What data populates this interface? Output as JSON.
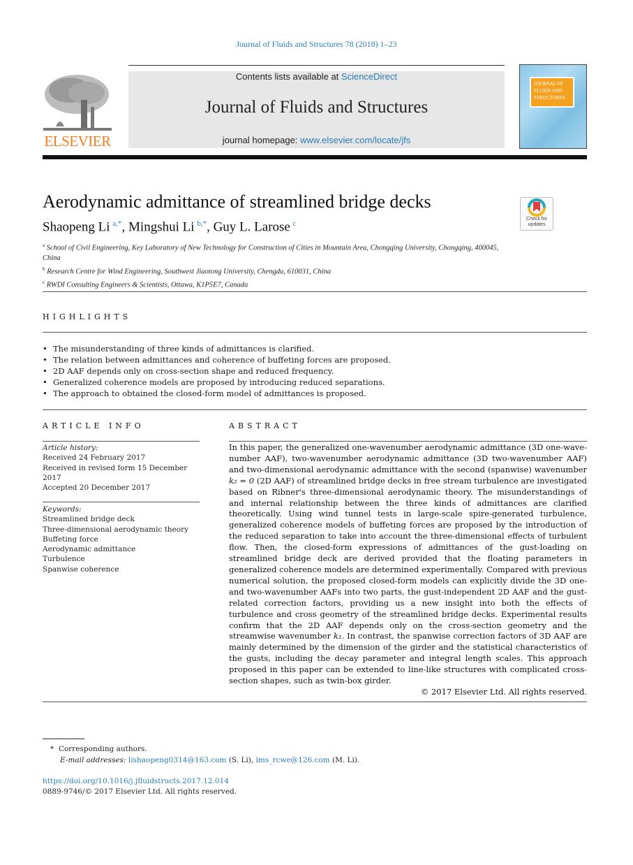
{
  "header": {
    "journal_reference": "Journal of Fluids and Structures 78 (2018) 1–23",
    "contents_prefix": "Contents lists available at ",
    "contents_link": "ScienceDirect",
    "journal_title": "Journal of Fluids and Structures",
    "homepage_prefix": "journal homepage: ",
    "homepage_link": "www.elsevier.com/locate/jfs",
    "publisher_logo_text": "ELSEVIER",
    "cover_title": "JOURNAL OF FLUIDS AND STRUCTURES",
    "check_updates_label": "Check for updates"
  },
  "article": {
    "title": "Aerodynamic admittance of streamlined bridge decks",
    "authors": [
      {
        "name": "Shaopeng Li",
        "sup": "a,*"
      },
      {
        "name": "Mingshui Li",
        "sup": "b,*"
      },
      {
        "name": "Guy L. Larose",
        "sup": "c"
      }
    ],
    "affiliations": [
      {
        "mark": "a",
        "text": "School of Civil Engineering, Key Laboratory of New Technology for Construction of Cities in Mountain Area, Chongqing University, Chongqing, 400045, China"
      },
      {
        "mark": "b",
        "text": "Research Centre for Wind Engineering, Southwest Jiaotong University, Chengdu, 610031, China"
      },
      {
        "mark": "c",
        "text": "RWDI Consulting Engineers & Scientists, Ottawa, K1P5E7, Canada"
      }
    ]
  },
  "highlights": {
    "heading": "HIGHLIGHTS",
    "items": [
      "The misunderstanding of three kinds of admittances is clarified.",
      "The relation between admittances and coherence of buffeting forces are proposed.",
      "2D AAF depends only on cross-section shape and reduced frequency.",
      "Generalized coherence models are proposed by introducing reduced separations.",
      "The approach to obtained the closed-form model of admittances is proposed."
    ]
  },
  "article_info": {
    "heading": "ARTICLE INFO",
    "history_label": "Article history:",
    "history": [
      "Received 24 February 2017",
      "Received in revised form 15 December 2017",
      "Accepted 20 December 2017"
    ],
    "keywords_label": "Keywords:",
    "keywords": [
      "Streamlined bridge deck",
      "Three-dimensional aerodynamic theory",
      "Buffeting force",
      "Aerodynamic admittance",
      "Turbulence",
      "Spanwise coherence"
    ]
  },
  "abstract": {
    "heading": "ABSTRACT",
    "part1": "In this paper, the generalized one-wavenumber aerodynamic admittance (3D one-wave-number AAF), two-wavenumber aerodynamic admittance (3D two-wavenumber AAF) and two-dimensional aerodynamic admittance with the second (spanwise) wavenumber ",
    "math1": "k₂ = 0",
    "part2": " (2D AAF) of streamlined bridge decks in free stream turbulence are investigated based on Ribner's three-dimensional aerodynamic theory. The misunderstandings of and internal relationship between the three kinds of admittances are clarified theoretically. Using wind tunnel tests in large-scale spire-generated turbulence, generalized coherence models of buffeting forces are proposed by the introduction of the reduced separation to take into account the three-dimensional effects of turbulent flow. Then, the closed-form expressions of admittances of the gust-loading on streamlined bridge deck are derived provided that the floating parameters in generalized coherence models are determined experimentally. Compared with previous numerical solution, the proposed closed-form models can explicitly divide the 3D one- and two-wavenumber AAFs into two parts, the gust-independent 2D AAF and the gust-related correction factors, providing us a new insight into both the effects of turbulence and cross geometry of the streamlined bridge decks. Experimental results confirm that the 2D AAF depends only on the cross-section geometry and the streamwise wavenumber ",
    "math2": "k₁",
    "part3": ". In contrast, the spanwise correction factors of 3D AAF are mainly determined by the dimension of the girder and the statistical characteristics of the gusts, including the decay parameter and integral length scales. This approach proposed in this paper can be extended to line-like structures with complicated cross-section shapes, such as twin-box girder.",
    "copyright": "© 2017 Elsevier Ltd. All rights reserved."
  },
  "footnotes": {
    "mark": "*",
    "corresponding": "Corresponding authors.",
    "email_label": "E-mail addresses:",
    "email1": "lishaopeng0314@163.com",
    "email1_owner": " (S. Li), ",
    "email2": "lms_rcwe@126.com",
    "email2_owner": " (M. Li)."
  },
  "doi": {
    "link": "https://doi.org/10.1016/j.jfluidstructs.2017.12.014",
    "issn": "0889-9746/© 2017 Elsevier Ltd. All rights reserved."
  }
}
